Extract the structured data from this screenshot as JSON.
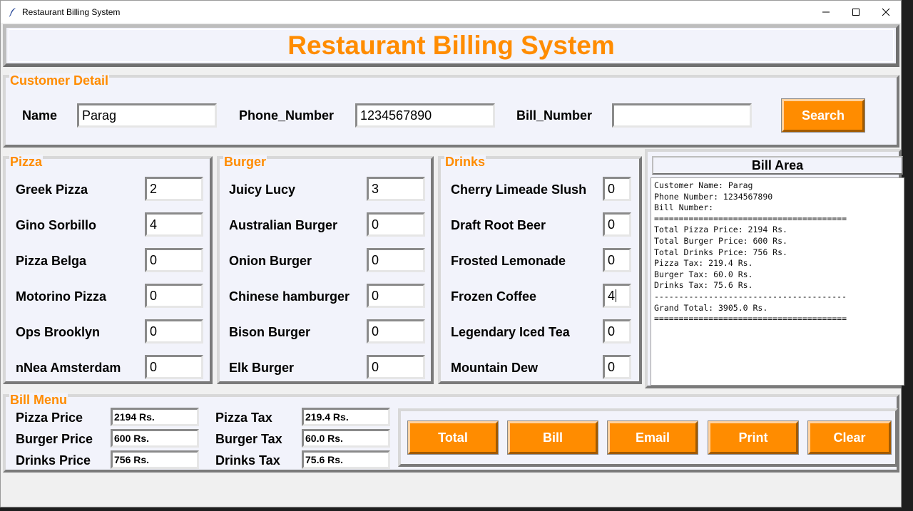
{
  "window": {
    "title": "Restaurant Billing System"
  },
  "header": {
    "title": "Restaurant Billing System"
  },
  "customer": {
    "legend": "Customer Detail",
    "name_label": "Name",
    "name_value": "Parag",
    "phone_label": "Phone_Number",
    "phone_value": "1234567890",
    "bill_label": "Bill_Number",
    "bill_value": "",
    "search_label": "Search"
  },
  "pizza": {
    "legend": "Pizza",
    "items": [
      {
        "label": "Greek Pizza",
        "qty": "2"
      },
      {
        "label": "Gino Sorbillo",
        "qty": "4"
      },
      {
        "label": "Pizza Belga",
        "qty": "0"
      },
      {
        "label": "Motorino Pizza",
        "qty": "0"
      },
      {
        "label": "Ops   Brooklyn",
        "qty": "0"
      },
      {
        "label": "nNea   Amsterdam",
        "qty": "0"
      }
    ]
  },
  "burger": {
    "legend": "Burger",
    "items": [
      {
        "label": "Juicy Lucy",
        "qty": "3"
      },
      {
        "label": "Australian Burger",
        "qty": "0"
      },
      {
        "label": "Onion Burger",
        "qty": "0"
      },
      {
        "label": "Chinese hamburger",
        "qty": "0"
      },
      {
        "label": "Bison Burger",
        "qty": "0"
      },
      {
        "label": "Elk Burger",
        "qty": "0"
      }
    ]
  },
  "drinks": {
    "legend": "Drinks",
    "items": [
      {
        "label": "Cherry Limeade Slush",
        "qty": "0"
      },
      {
        "label": "Draft Root Beer",
        "qty": "0"
      },
      {
        "label": "Frosted Lemonade",
        "qty": "0"
      },
      {
        "label": "Frozen Coffee",
        "qty": "4"
      },
      {
        "label": "Legendary Iced Tea",
        "qty": "0"
      },
      {
        "label": "Mountain Dew",
        "qty": "0"
      }
    ]
  },
  "bill_area": {
    "title": "Bill Area",
    "text": "Customer Name: Parag\nPhone Number: 1234567890\nBill Number:\n=======================================\nTotal Pizza Price: 2194 Rs.\nTotal Burger Price: 600 Rs.\nTotal Drinks Price: 756 Rs.\nPizza Tax: 219.4 Rs.\nBurger Tax: 60.0 Rs.\nDrinks Tax: 75.6 Rs.\n---------------------------------------\nGrand Total: 3905.0 Rs.\n======================================="
  },
  "bill_menu": {
    "legend": "Bill Menu",
    "pizza_price_label": "Pizza Price",
    "pizza_price": "2194 Rs.",
    "burger_price_label": "Burger Price",
    "burger_price": "600 Rs.",
    "drinks_price_label": "Drinks Price",
    "drinks_price": "756 Rs.",
    "pizza_tax_label": "Pizza Tax",
    "pizza_tax": "219.4 Rs.",
    "burger_tax_label": "Burger Tax",
    "burger_tax": "60.0 Rs.",
    "drinks_tax_label": "Drinks Tax",
    "drinks_tax": "75.6 Rs."
  },
  "actions": {
    "total": "Total",
    "bill": "Bill",
    "email": "Email",
    "print": "Print",
    "clear": "Clear"
  },
  "colors": {
    "accent": "#ff8c00",
    "panel": "#f2f3fb"
  }
}
